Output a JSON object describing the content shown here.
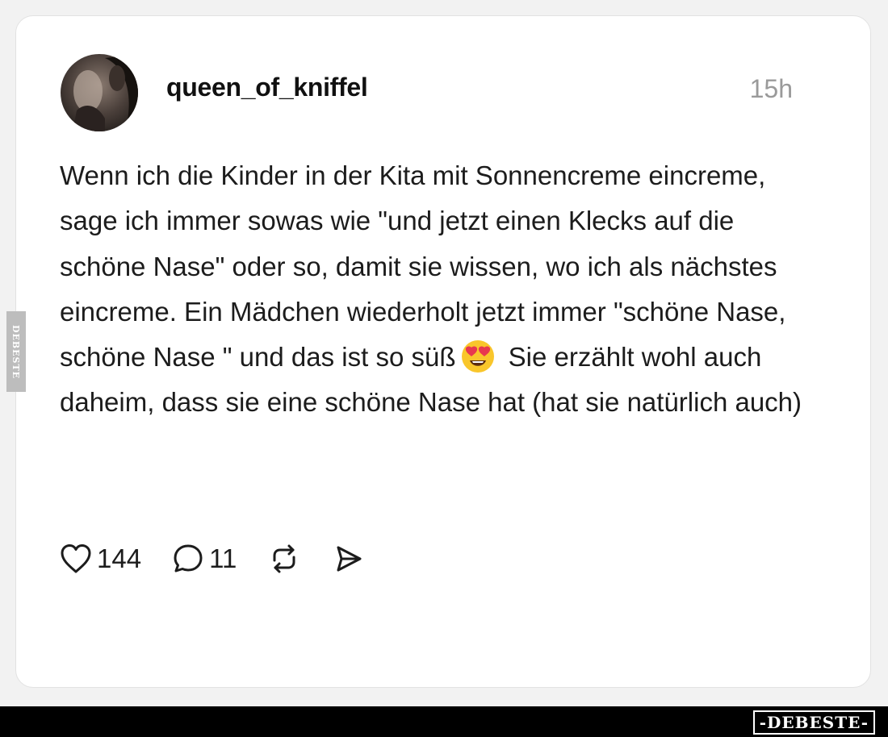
{
  "post": {
    "username": "queen_of_kniffel",
    "timestamp": "15h",
    "text_before_emoji": "Wenn ich die Kinder in der Kita mit Sonnencreme eincreme, sage ich immer sowas wie \"und jetzt einen Klecks auf die schöne Nase\" oder so, damit sie wissen, wo ich als nächstes eincreme. Ein Mädchen wiederholt jetzt immer \"schöne Nase, schöne Nase \" und das ist so süß",
    "emoji": "heart-eyes-emoji",
    "text_after_emoji": "Sie erzählt wohl auch daheim, dass sie eine schöne Nase hat (hat sie natürlich auch)",
    "likes": "144",
    "comments": "11"
  },
  "icons": {
    "like": "heart-icon",
    "comment": "speech-bubble-icon",
    "repost": "repost-icon",
    "share": "send-icon"
  },
  "watermark": {
    "side": "DEBESTE",
    "logo": "-DEBESTE-"
  },
  "colors": {
    "background": "#f2f2f2",
    "card": "#ffffff",
    "text": "#1c1c1c",
    "timestamp": "#9a9a9a",
    "emoji": "#f9c62b",
    "emoji_hearts": "#e8384f"
  }
}
